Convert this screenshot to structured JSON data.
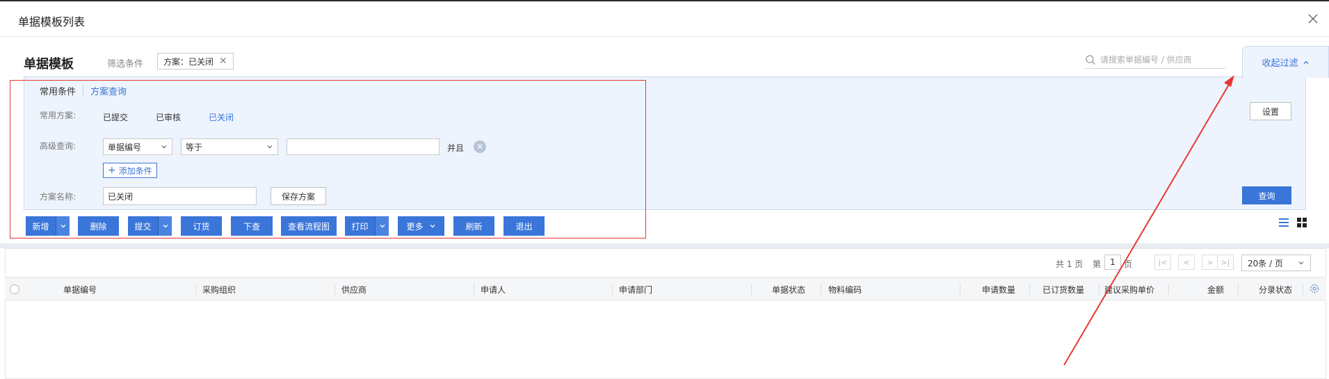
{
  "window": {
    "title": "单据模板列表"
  },
  "header": {
    "section_title": "单据模板",
    "filter_label": "筛选条件",
    "filter_chip": "方案：已关闭",
    "search_placeholder": "请搜索单据编号 / 供应商",
    "collapse_label": "收起过滤"
  },
  "filter": {
    "tabs": {
      "active": "常用条件",
      "other": "方案查询"
    },
    "common_plan_label": "常用方案:",
    "plans": [
      "已提交",
      "已审核",
      "已关闭"
    ],
    "selected_plan": "已关闭",
    "advanced_label": "高级查询:",
    "field_select": "单据编号",
    "operator_select": "等于",
    "value_input": "",
    "and_label": "并且",
    "add_condition": "添加条件",
    "plan_name_label": "方案名称:",
    "plan_name_value": "已关闭",
    "save_plan": "保存方案",
    "settings": "设置",
    "query": "查询"
  },
  "toolbar": {
    "add": "新增",
    "delete": "删除",
    "submit": "提交",
    "order": "订货",
    "push_down": "下查",
    "flowchart": "查看流程图",
    "print": "打印",
    "more": "更多",
    "refresh": "刷新",
    "exit": "退出"
  },
  "pager": {
    "total": "共 1 页",
    "di": "第",
    "page": "1",
    "ye": "页",
    "page_size": "20条 / 页"
  },
  "table": {
    "columns": [
      "单据编号",
      "采购组织",
      "供应商",
      "申请人",
      "申请部门",
      "单据状态",
      "物料编码",
      "申请数量",
      "已订货数量",
      "建议采购单价",
      "金额",
      "分录状态"
    ]
  },
  "colors": {
    "accent": "#3a75d9",
    "annotation": "#e53935"
  }
}
